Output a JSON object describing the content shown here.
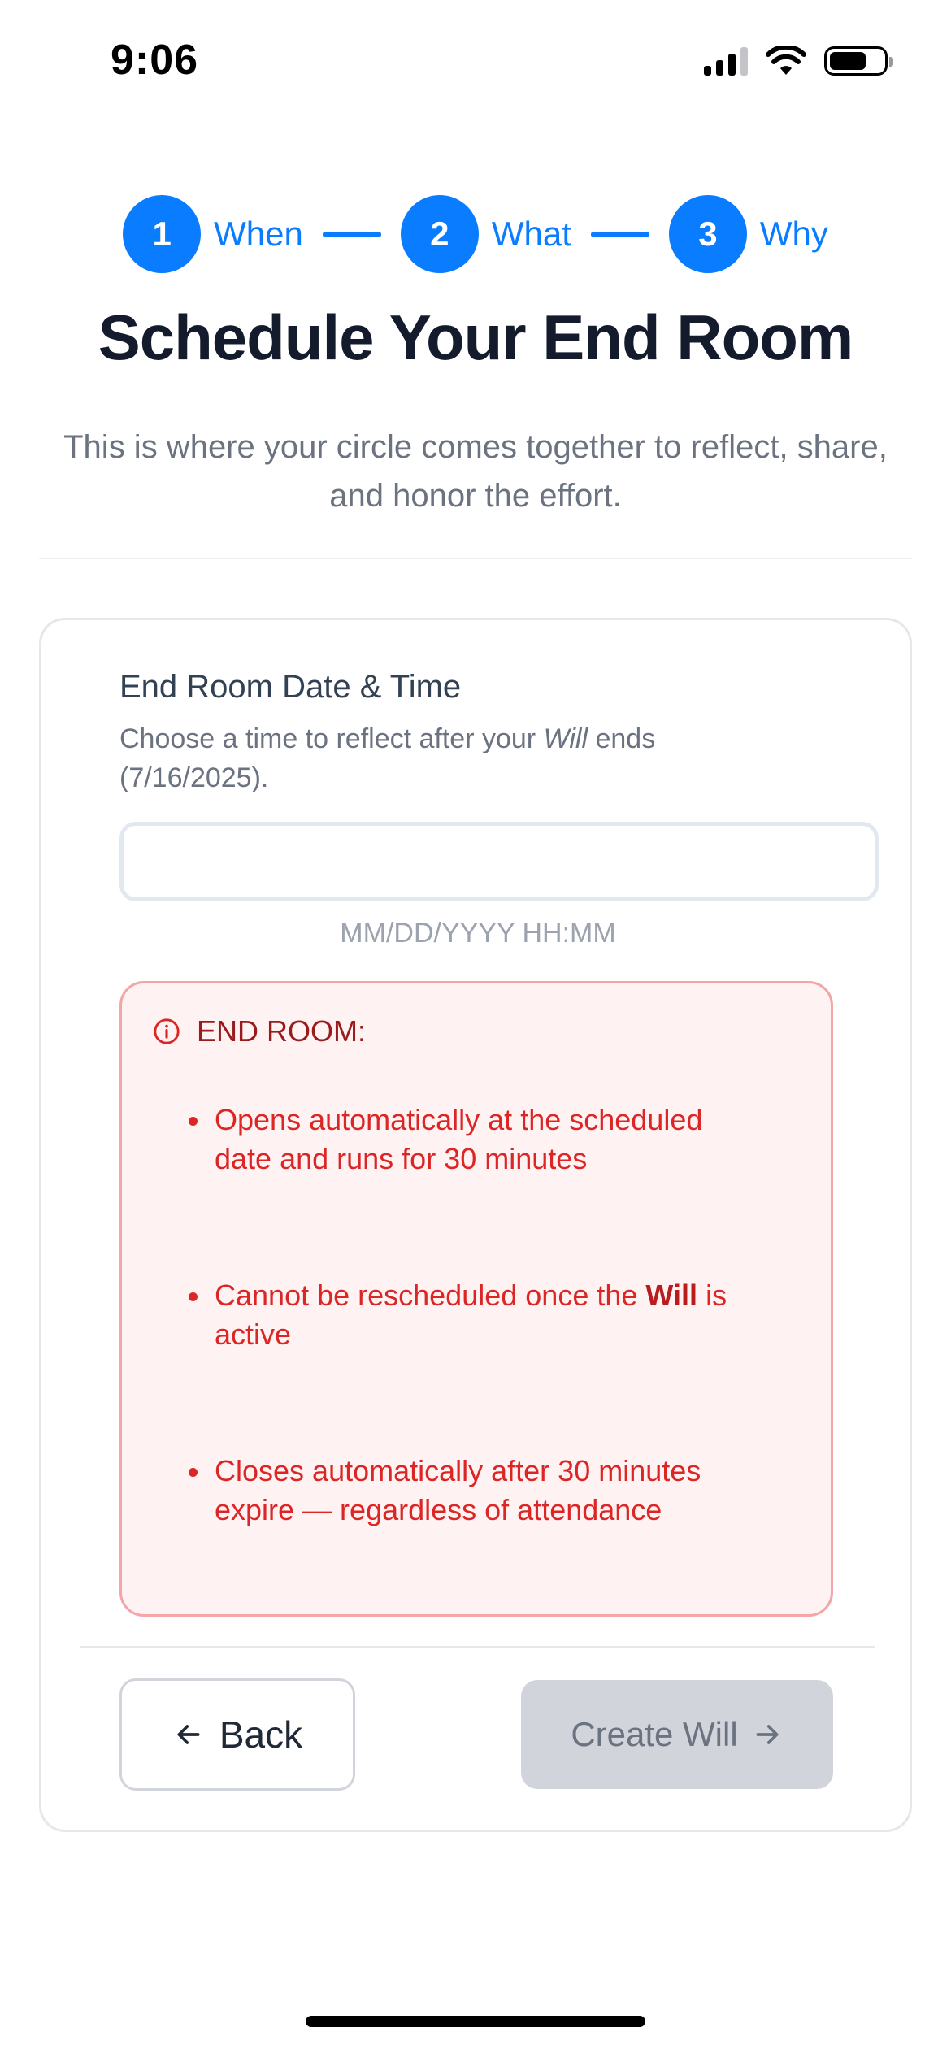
{
  "status_bar": {
    "time": "9:06",
    "icons": [
      "signal-icon",
      "wifi-icon",
      "battery-icon"
    ]
  },
  "stepper": {
    "steps": [
      {
        "number": "1",
        "label": "When"
      },
      {
        "number": "2",
        "label": "What"
      },
      {
        "number": "3",
        "label": "Why"
      }
    ],
    "accent_color": "#0a7cff"
  },
  "header": {
    "title": "Schedule Your End Room",
    "subtitle": "This is where your circle comes together to reflect, share, and honor the effort."
  },
  "form": {
    "label": "End Room Date & Time",
    "help_prefix": "Choose a time to reflect after your ",
    "help_emphasis": "Will",
    "help_suffix": " ends (7/16/2025).",
    "input_value": "",
    "format_hint": "MM/DD/YYYY HH:MM"
  },
  "alert": {
    "icon": "info-icon",
    "title": "END ROOM:",
    "items": [
      {
        "text": "Opens automatically at the scheduled date and runs for 30 minutes"
      },
      {
        "prefix": "Cannot be rescheduled once the ",
        "bold": "Will",
        "suffix": " is active"
      },
      {
        "text": "Closes automatically after 30 minutes expire — regardless of attendance"
      }
    ],
    "text_color": "#dc2626",
    "background": "#fef2f2"
  },
  "actions": {
    "back_label": "Back",
    "create_label": "Create Will",
    "create_disabled": true
  }
}
